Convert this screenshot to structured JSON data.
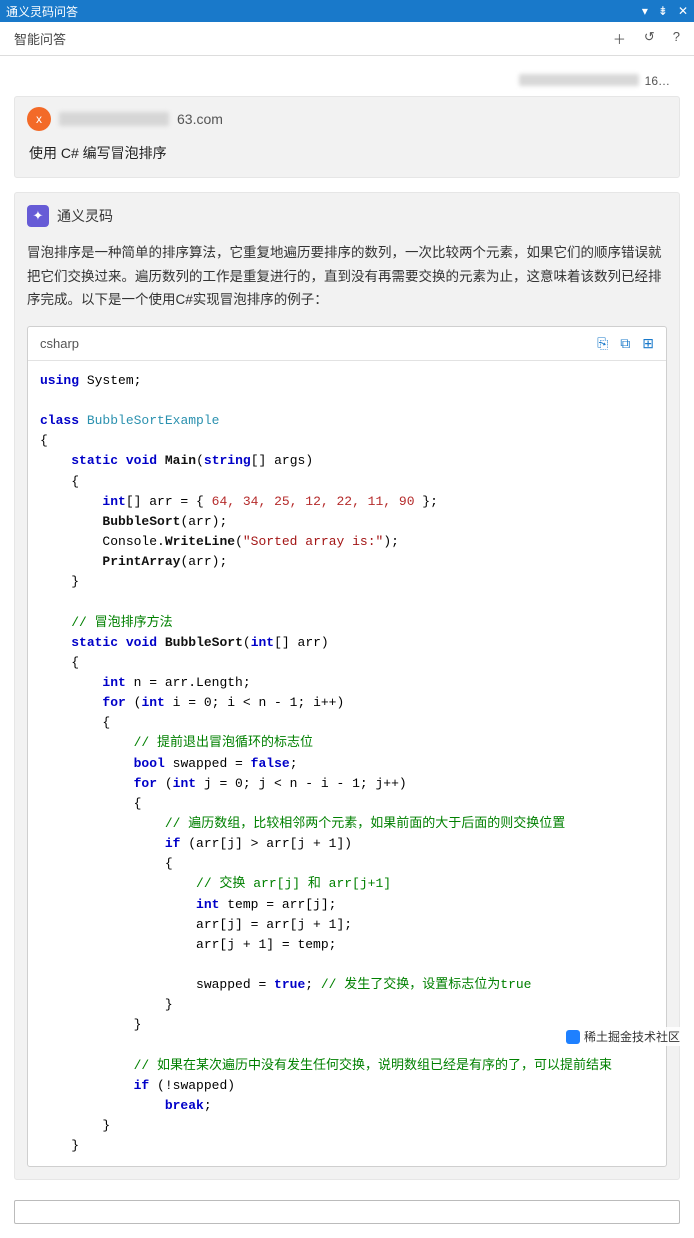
{
  "titlebar": {
    "title": "通义灵码问答"
  },
  "toolbar": {
    "label": "智能问答"
  },
  "timestamp_suffix": "16…",
  "user": {
    "avatar_letter": "x",
    "email_suffix": "63.com",
    "prompt": "使用 C# 编写冒泡排序"
  },
  "ai": {
    "name": "通义灵码",
    "explanation": "冒泡排序是一种简单的排序算法，它重复地遍历要排序的数列，一次比较两个元素，如果它们的顺序错误就把它们交换过来。遍历数列的工作是重复进行的，直到没有再需要交换的元素为止，这意味着该数列已经排序完成。以下是一个使用C#实现冒泡排序的例子："
  },
  "code": {
    "language": "csharp",
    "lines": {
      "using": "using",
      "system": "System",
      "class_kw": "class",
      "class_name": "BubbleSortExample",
      "static": "static",
      "void": "void",
      "main": "Main",
      "string": "string",
      "args": "[] args",
      "int": "int",
      "arr_decl": "[] arr = { ",
      "arr_vals": "64, 34, 25, 12, 22, 11, 90",
      "arr_end": " };",
      "bubblesort": "BubbleSort",
      "arr": "arr",
      "console": "Console",
      "writeline": "WriteLine",
      "sorted_msg": "\"Sorted array is:\"",
      "printarray": "PrintArray",
      "cmt_method": "// 冒泡排序方法",
      "n_decl": " n = arr.Length;",
      "for": "for",
      "i_init": " i = 0; i < n - 1; i++",
      "cmt_flag": "// 提前退出冒泡循环的标志位",
      "bool": "bool",
      "swapped_false": " swapped = ",
      "false": "false",
      "j_init": " j = 0; j < n - i - 1; j++",
      "cmt_compare": "// 遍历数组，比较相邻两个元素，如果前面的大于后面的则交换位置",
      "if": "if",
      "if_cond": " (arr[j] > arr[j + 1])",
      "cmt_swap": "// 交换 arr[j] 和 arr[j+1]",
      "temp_decl": " temp = arr[j];",
      "swap1": "arr[j] = arr[j + 1];",
      "swap2": "arr[j + 1] = temp;",
      "swapped_true": "swapped = ",
      "true": "true",
      "cmt_true": "// 发生了交换，设置标志位为true",
      "cmt_early": "// 如果在某次遍历中没有发生任何交换，说明数组已经是有序的了，可以提前结束",
      "if_not_swapped": " (!swapped)",
      "break": "break"
    }
  },
  "watermark": "稀土掘金技术社区"
}
